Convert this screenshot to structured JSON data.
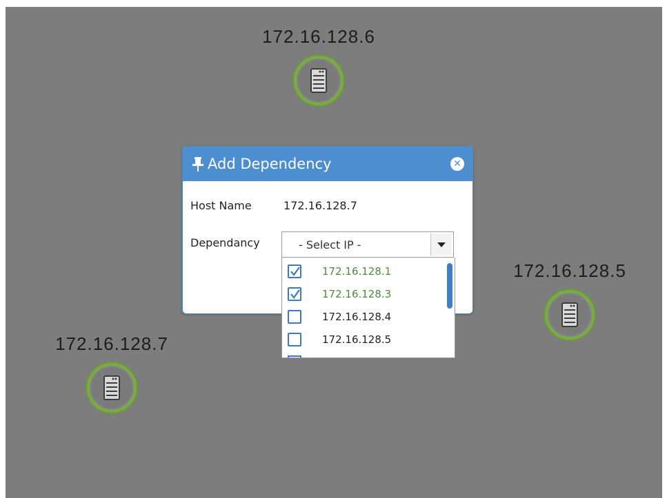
{
  "nodes": [
    {
      "label": "172.16.128.6",
      "icon": "server-icon",
      "status_color": "#7aab46"
    },
    {
      "label": "172.16.128.5",
      "icon": "server-icon",
      "status_color": "#7aab46"
    },
    {
      "label": "172.16.128.7",
      "icon": "server-icon",
      "status_color": "#7aab46"
    }
  ],
  "dialog": {
    "title": "Add Dependency",
    "title_icon": "pin-icon",
    "close_icon": "close-icon",
    "host_name_label": "Host Name",
    "host_name_value": "172.16.128.7",
    "dependency_label": "Dependancy",
    "select": {
      "value": "- Select IP -",
      "options": [
        {
          "label": "172.16.128.1",
          "checked": true
        },
        {
          "label": "172.16.128.3",
          "checked": true
        },
        {
          "label": "172.16.128.4",
          "checked": false
        },
        {
          "label": "172.16.128.5",
          "checked": false
        }
      ]
    }
  },
  "colors": {
    "canvas_bg": "#7d7d7d",
    "header_bg": "#4d8ed0",
    "checked_text": "#4e8a3a",
    "node_ring": "#7aab46"
  }
}
